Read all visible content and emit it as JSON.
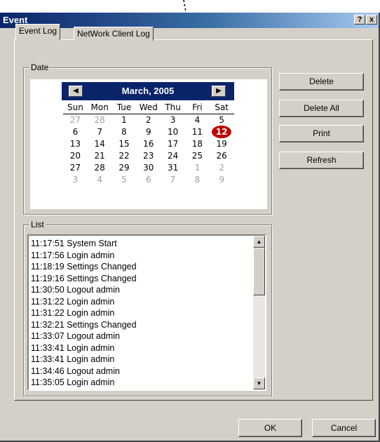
{
  "window": {
    "title": "Event",
    "help_label": "?",
    "close_label": "x"
  },
  "tabs": [
    {
      "label": "Event Log"
    },
    {
      "label": "NetWork Client Log"
    }
  ],
  "date_group": {
    "label": "Date"
  },
  "calendar": {
    "month_title": "March, 2005",
    "prev_icon": "left-triangle-icon",
    "next_icon": "right-triangle-icon",
    "weekdays": [
      "Sun",
      "Mon",
      "Tue",
      "Wed",
      "Thu",
      "Fri",
      "Sat"
    ],
    "weeks": [
      [
        "27",
        "28",
        "1",
        "2",
        "3",
        "4",
        "5"
      ],
      [
        "6",
        "7",
        "8",
        "9",
        "10",
        "11",
        "12"
      ],
      [
        "13",
        "14",
        "15",
        "16",
        "17",
        "18",
        "19"
      ],
      [
        "20",
        "21",
        "22",
        "23",
        "24",
        "25",
        "26"
      ],
      [
        "27",
        "28",
        "29",
        "30",
        "31",
        "1",
        "2"
      ],
      [
        "3",
        "4",
        "5",
        "6",
        "7",
        "8",
        "9"
      ]
    ],
    "selected_day": "12",
    "selected_color": "#c00000"
  },
  "list_group": {
    "label": "List"
  },
  "log_entries": [
    "11:17:51 System Start",
    "11:17:56 Login admin",
    "11:18:19 Settings Changed",
    "11:19:16 Settings Changed",
    "11:30:50 Logout admin",
    "11:31:22 Login admin",
    "11:31:22 Login admin",
    "11:32:21 Settings Changed",
    "11:33:07 Logout admin",
    "11:33:41 Login admin",
    "11:33:41 Login admin",
    "11:34:46 Logout admin",
    "11:35:05 Login admin"
  ],
  "buttons": {
    "delete": "Delete",
    "delete_all": "Delete All",
    "print": "Print",
    "refresh": "Refresh",
    "ok": "OK",
    "cancel": "Cancel"
  },
  "colors": {
    "title_bar": "#0a246a",
    "dialog_face": "#d4d0c8",
    "calendar_header": "#0a246a"
  }
}
